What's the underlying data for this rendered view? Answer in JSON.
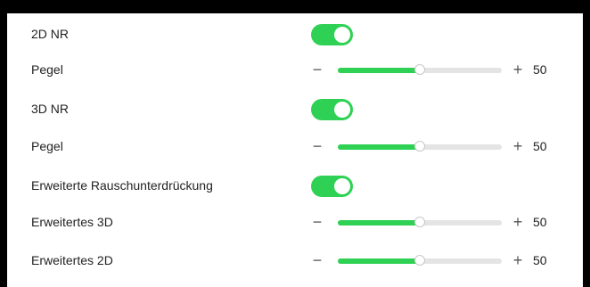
{
  "colors": {
    "accent": "#2fd154",
    "track": "#e4e4e4",
    "frame": "#000000"
  },
  "rows": [
    {
      "label": "2D NR",
      "type": "toggle",
      "on": true
    },
    {
      "label": "Pegel",
      "type": "slider",
      "minus": "−",
      "plus": "+",
      "value": "50",
      "fraction": 0.5
    },
    {
      "label": "3D NR",
      "type": "toggle",
      "on": true
    },
    {
      "label": "Pegel",
      "type": "slider",
      "minus": "−",
      "plus": "+",
      "value": "50",
      "fraction": 0.5
    },
    {
      "label": "Erweiterte Rauschunterdrückung",
      "type": "toggle",
      "on": true
    },
    {
      "label": "Erweitertes 3D",
      "type": "slider",
      "minus": "−",
      "plus": "+",
      "value": "50",
      "fraction": 0.5
    },
    {
      "label": "Erweitertes 2D",
      "type": "slider",
      "minus": "−",
      "plus": "+",
      "value": "50",
      "fraction": 0.5
    }
  ]
}
